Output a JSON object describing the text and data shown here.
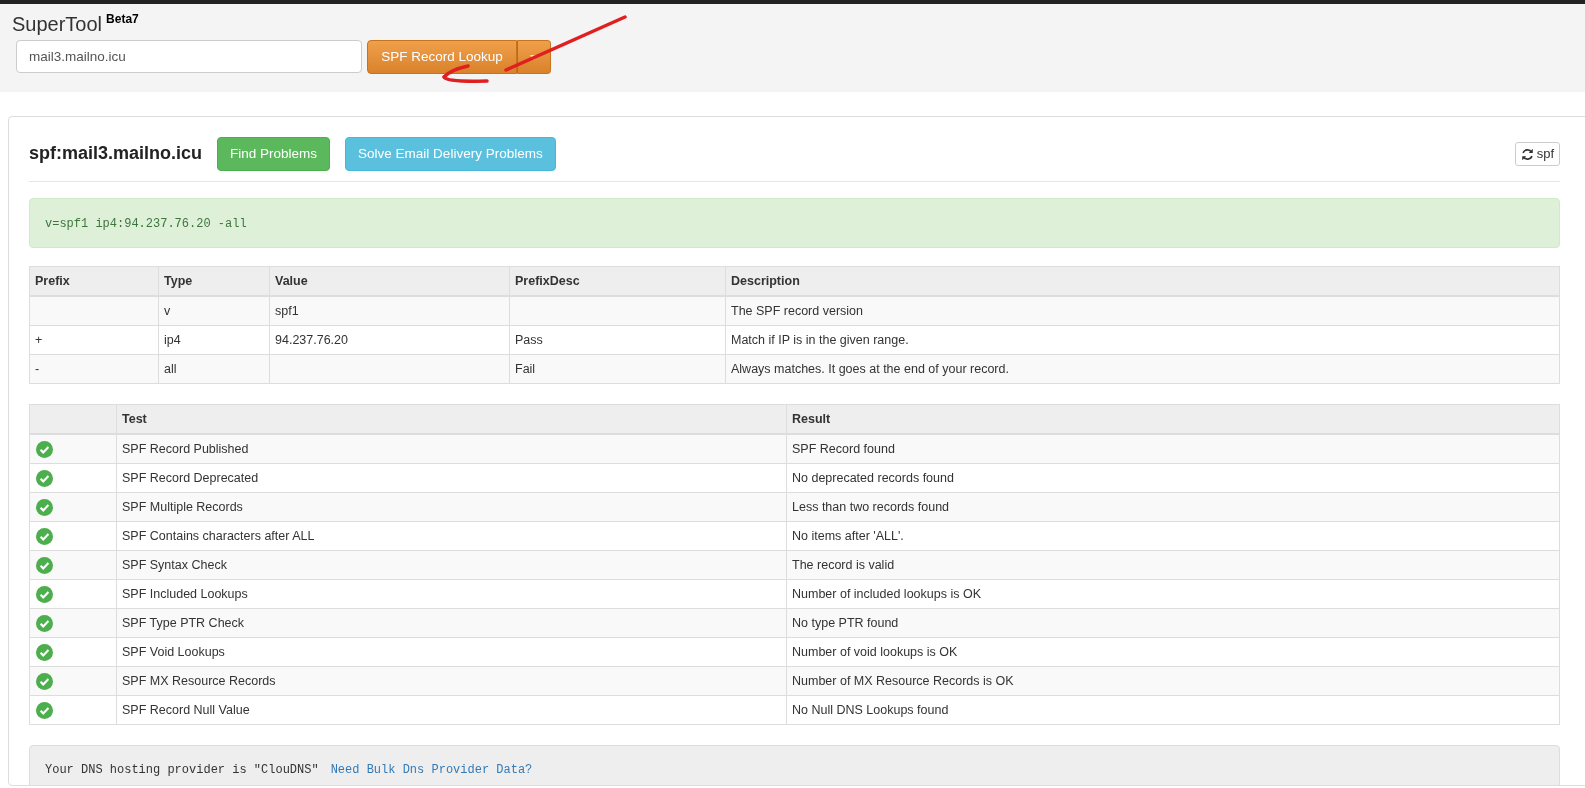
{
  "app": {
    "title": "SuperTool",
    "badge": "Beta7"
  },
  "search": {
    "value": "mail3.mailno.icu",
    "button": "SPF Record Lookup"
  },
  "result": {
    "heading": "spf:mail3.mailno.icu",
    "buttons": [
      {
        "label": "Find Problems",
        "kind": "success"
      },
      {
        "label": "Solve Email Delivery Problems",
        "kind": "info"
      }
    ],
    "refresh_label": "spf",
    "record": "v=spf1 ip4:94.237.76.20 -all"
  },
  "prefix_table": {
    "columns": [
      "Prefix",
      "Type",
      "Value",
      "PrefixDesc",
      "Description"
    ],
    "rows": [
      [
        "",
        "v",
        "spf1",
        "",
        "The SPF record version"
      ],
      [
        "+",
        "ip4",
        "94.237.76.20",
        "Pass",
        "Match if IP is in the given range."
      ],
      [
        "-",
        "all",
        "",
        "Fail",
        "Always matches. It goes at the end of your record."
      ]
    ]
  },
  "test_table": {
    "columns": [
      "Test",
      "Result"
    ],
    "rows": [
      {
        "passed": true,
        "test": "SPF Record Published",
        "result": "SPF Record found"
      },
      {
        "passed": true,
        "test": "SPF Record Deprecated",
        "result": "No deprecated records found"
      },
      {
        "passed": true,
        "test": "SPF Multiple Records",
        "result": "Less than two records found"
      },
      {
        "passed": true,
        "test": "SPF Contains characters after ALL",
        "result": "No items after 'ALL'."
      },
      {
        "passed": true,
        "test": "SPF Syntax Check",
        "result": "The record is valid"
      },
      {
        "passed": true,
        "test": "SPF Included Lookups",
        "result": "Number of included lookups is OK"
      },
      {
        "passed": true,
        "test": "SPF Type PTR Check",
        "result": "No type PTR found"
      },
      {
        "passed": true,
        "test": "SPF Void Lookups",
        "result": "Number of void lookups is OK"
      },
      {
        "passed": true,
        "test": "SPF MX Resource Records",
        "result": "Number of MX Resource Records is OK"
      },
      {
        "passed": true,
        "test": "SPF Record Null Value",
        "result": "No Null DNS Lookups found"
      }
    ]
  },
  "provider": {
    "text": "Your DNS hosting provider is \"ClouDNS\"",
    "link": "Need Bulk Dns Provider Data?"
  }
}
